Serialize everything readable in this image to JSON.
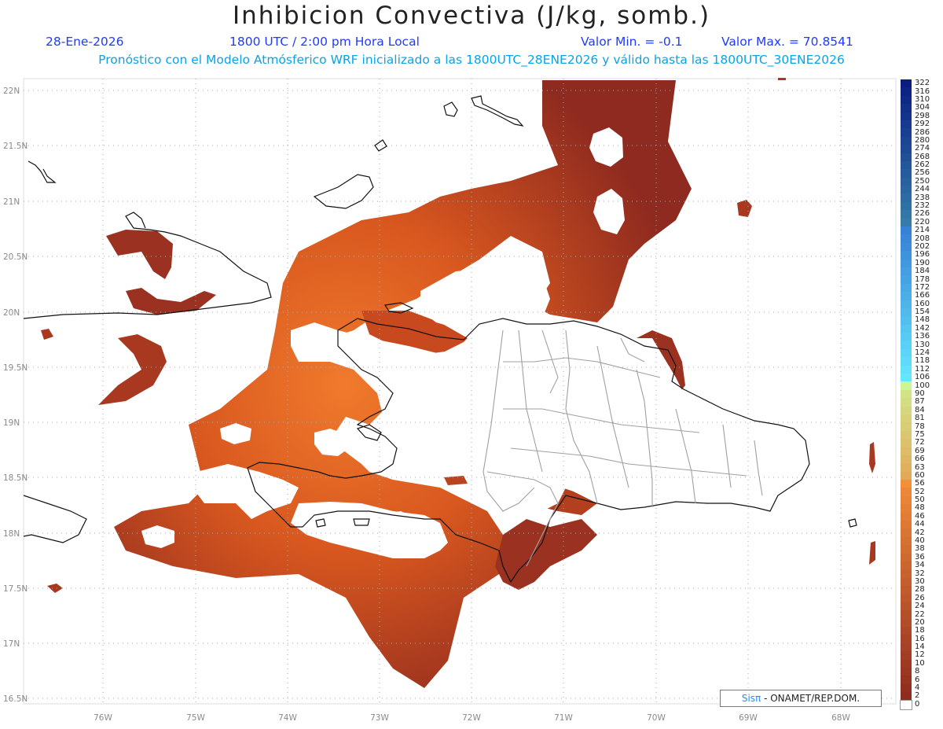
{
  "header": {
    "title": "Inhibicion Convectiva (J/kg, somb.)",
    "date": "28-Ene-2026",
    "time": "1800 UTC / 2:00 pm Hora Local",
    "min_label": "Valor Min. = -0.1",
    "max_label": "Valor Max. = 70.8541",
    "forecast_info": "Pronóstico con el Modelo Atmósferico WRF inicializado a las 1800UTC_28ENE2026 y válido hasta las  1800UTC_30ENE2026"
  },
  "map": {
    "lat_labels": [
      "22N",
      "21.5N",
      "21N",
      "20.5N",
      "20N",
      "19.5N",
      "19N",
      "18.5N",
      "18N",
      "17.5N",
      "17N",
      "16.5N"
    ],
    "lon_labels": [
      "76W",
      "75W",
      "74W",
      "73W",
      "72W",
      "71W",
      "70W",
      "69W",
      "68W"
    ],
    "shading_color_dark": "#8e2a1f",
    "shading_color_mid": "#c4451e",
    "shading_color_light": "#f07a2c"
  },
  "colorbar": {
    "labels": [
      "322",
      "316",
      "310",
      "304",
      "298",
      "292",
      "286",
      "280",
      "274",
      "268",
      "262",
      "256",
      "250",
      "244",
      "238",
      "232",
      "226",
      "220",
      "214",
      "208",
      "202",
      "196",
      "190",
      "184",
      "178",
      "172",
      "166",
      "160",
      "154",
      "148",
      "142",
      "136",
      "130",
      "124",
      "118",
      "112",
      "106",
      "100",
      "90",
      "87",
      "84",
      "81",
      "78",
      "75",
      "72",
      "69",
      "66",
      "63",
      "60",
      "56",
      "52",
      "50",
      "48",
      "46",
      "44",
      "42",
      "40",
      "38",
      "36",
      "34",
      "32",
      "30",
      "28",
      "26",
      "24",
      "22",
      "20",
      "18",
      "16",
      "14",
      "12",
      "10",
      "8",
      "6",
      "4",
      "2",
      "0"
    ]
  },
  "credit": {
    "brand": "Sisπ",
    "org": " - ONAMET/REP.DOM."
  }
}
